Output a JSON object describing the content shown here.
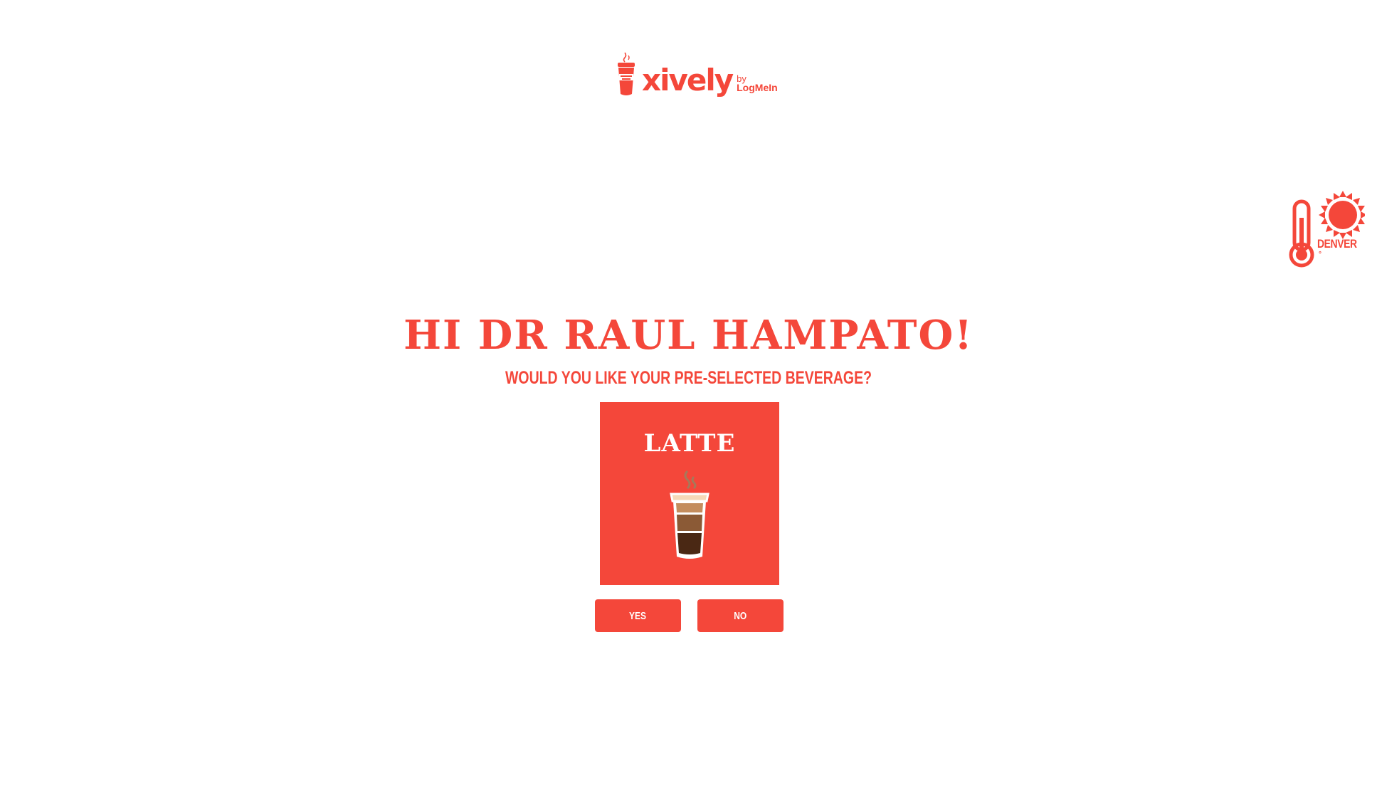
{
  "brand": {
    "name": "xively",
    "by": "by",
    "byline": "LogMeIn",
    "accent": "#f4473a"
  },
  "weather": {
    "city": "DENVER",
    "temperature": "°",
    "icons": [
      "thermometer-icon",
      "sun-icon"
    ]
  },
  "greeting": {
    "title": "HI DR RAUL HAMPATO!",
    "question": "WOULD YOU LIKE YOUR PRE-SELECTED BEVERAGE?"
  },
  "beverage": {
    "name": "LATTE",
    "icon": "latte-cup-icon"
  },
  "actions": {
    "yes_label": "YES",
    "no_label": "NO"
  }
}
